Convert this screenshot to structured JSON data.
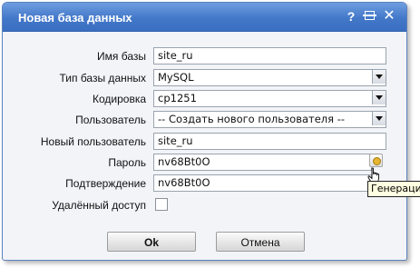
{
  "window": {
    "title": "Новая база данных",
    "controls": {
      "help_icon": "?",
      "close_icon": "✕"
    }
  },
  "form": {
    "db_name": {
      "label": "Имя базы",
      "value": "site_ru"
    },
    "db_type": {
      "label": "Тип базы данных",
      "value": "MySQL"
    },
    "encoding": {
      "label": "Кодировка",
      "value": "cp1251"
    },
    "user": {
      "label": "Пользователь",
      "value": "-- Создать нового пользователя --"
    },
    "new_user": {
      "label": "Новый пользователь",
      "value": "site_ru"
    },
    "password": {
      "label": "Пароль",
      "value": "nv68Bt0O"
    },
    "confirm": {
      "label": "Подтверждение",
      "value": "nv68Bt0O"
    },
    "remote_access": {
      "label": "Удалённый доступ",
      "checked": false
    }
  },
  "tooltip": {
    "text": "Генерация"
  },
  "buttons": {
    "ok": "Ok",
    "cancel": "Отмена"
  },
  "icons": {
    "help": "help-icon",
    "maximize": "maximize-icon",
    "close": "close-icon",
    "generate": "key-icon",
    "cursor": "hand-cursor-icon",
    "select_arrow": "chevron-down-icon"
  },
  "colors": {
    "titlebar": "#4378c9",
    "dialog_background": "#f2f4f8",
    "border": "#5b82bd",
    "tooltip_background": "#ffffe1"
  }
}
